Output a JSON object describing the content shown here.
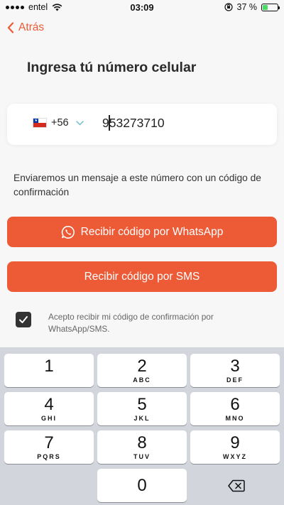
{
  "status_bar": {
    "carrier": "entel",
    "time": "03:09",
    "battery": "37 %",
    "battery_level": 0.37,
    "battery_color": "#4cd964"
  },
  "nav": {
    "back_label": "Atrás"
  },
  "title": "Ingresa tú número celular",
  "phone": {
    "country_code": "+56",
    "country_flag": "chile-flag",
    "number": "953273710"
  },
  "description": "Enviaremos un mensaje a este número con un código de confirmación",
  "buttons": {
    "whatsapp_label": "Recibir código por WhatsApp",
    "sms_label": "Recibir código por SMS",
    "accent_color": "#ec5a36"
  },
  "consent": {
    "checked": true,
    "text": "Acepto recibir mi código de confirmación por WhatsApp/SMS."
  },
  "keypad": {
    "keys": [
      {
        "num": "1",
        "letters": ""
      },
      {
        "num": "2",
        "letters": "ABC"
      },
      {
        "num": "3",
        "letters": "DEF"
      },
      {
        "num": "4",
        "letters": "GHI"
      },
      {
        "num": "5",
        "letters": "JKL"
      },
      {
        "num": "6",
        "letters": "MNO"
      },
      {
        "num": "7",
        "letters": "PQRS"
      },
      {
        "num": "8",
        "letters": "TUV"
      },
      {
        "num": "9",
        "letters": "WXYZ"
      },
      {
        "num": "0",
        "letters": ""
      }
    ]
  }
}
